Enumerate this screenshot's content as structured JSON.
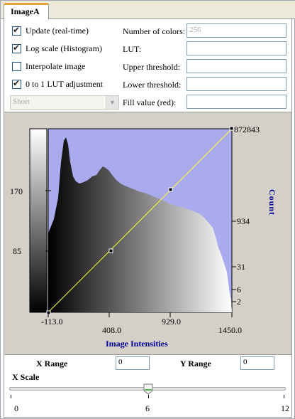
{
  "tab": {
    "label": "ImageA"
  },
  "options": {
    "update": {
      "label": "Update (real-time)",
      "checked": true
    },
    "log_scale": {
      "label": "Log scale (Histogram)",
      "checked": true
    },
    "interpolate": {
      "label": "Interpolate image",
      "checked": false
    },
    "lut_adjust": {
      "label": "0 to 1 LUT adjustment",
      "checked": true
    }
  },
  "fields": {
    "num_colors": {
      "label": "Number of colors:",
      "value": "256"
    },
    "lut": {
      "label": "LUT:",
      "value": ""
    },
    "upper": {
      "label": "Upper threshold:",
      "value": ""
    },
    "lower": {
      "label": "Lower threshold:",
      "value": ""
    },
    "fill": {
      "label": "Fill value (red):",
      "value": ""
    }
  },
  "type_select": {
    "value": "Short"
  },
  "histogram": {
    "left_ticks": [
      "170",
      "85"
    ],
    "right_ticks": [
      "872843",
      "934",
      "31",
      "6",
      "2"
    ],
    "x_ticks": [
      "-113.0",
      "408.0",
      "929.0",
      "1450.0"
    ],
    "xlabel": "Image Intensities",
    "ylabel": "Count"
  },
  "range": {
    "x_label": "X Range",
    "x_value": "0",
    "y_label": "Y Range",
    "y_value": "0"
  },
  "scale": {
    "label": "X Scale",
    "min": "0",
    "mid": "6",
    "max": "12",
    "value": 6
  },
  "colors": {
    "plot_bg": "#aaaaee",
    "lut_line": "#ffff33",
    "ylabel": "#000099",
    "xlabel": "#000099"
  }
}
